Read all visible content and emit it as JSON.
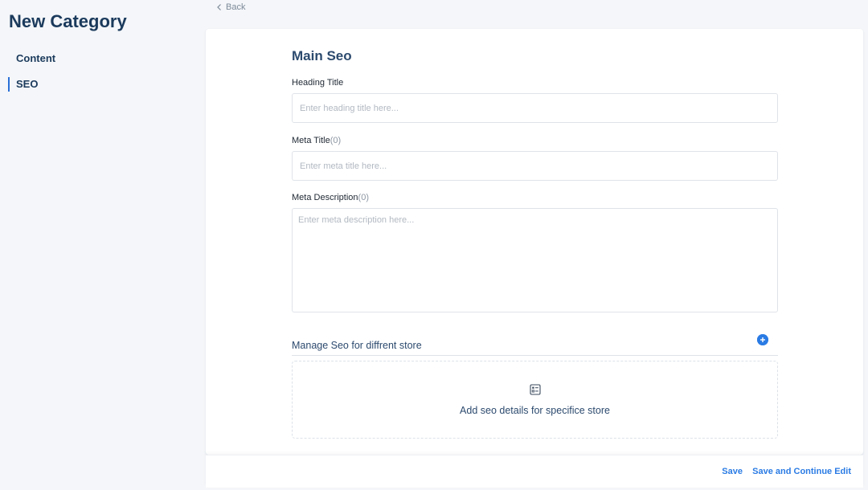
{
  "page": {
    "title": "New Category",
    "back_label": "Back"
  },
  "sidebar": {
    "items": [
      {
        "label": "Content",
        "active": false
      },
      {
        "label": "SEO",
        "active": true
      }
    ]
  },
  "main_seo": {
    "section_title": "Main Seo",
    "heading_title": {
      "label": "Heading Title",
      "placeholder": "Enter heading title here...",
      "value": ""
    },
    "meta_title": {
      "label": "Meta Title",
      "count": "(0)",
      "placeholder": "Enter meta title here...",
      "value": ""
    },
    "meta_description": {
      "label": "Meta Description",
      "count": "(0)",
      "placeholder": "Enter meta description here...",
      "value": ""
    }
  },
  "store_seo": {
    "title": "Manage Seo for diffrent store",
    "add_icon": "plus-circle-icon",
    "empty_icon": "list-card-icon",
    "empty_text": "Add seo details for specifice store"
  },
  "footer": {
    "save_label": "Save",
    "save_continue_label": "Save and Continue Edit"
  },
  "colors": {
    "accent": "#2a7be4",
    "title": "#1b3a5c",
    "background": "#f4f6f9"
  }
}
